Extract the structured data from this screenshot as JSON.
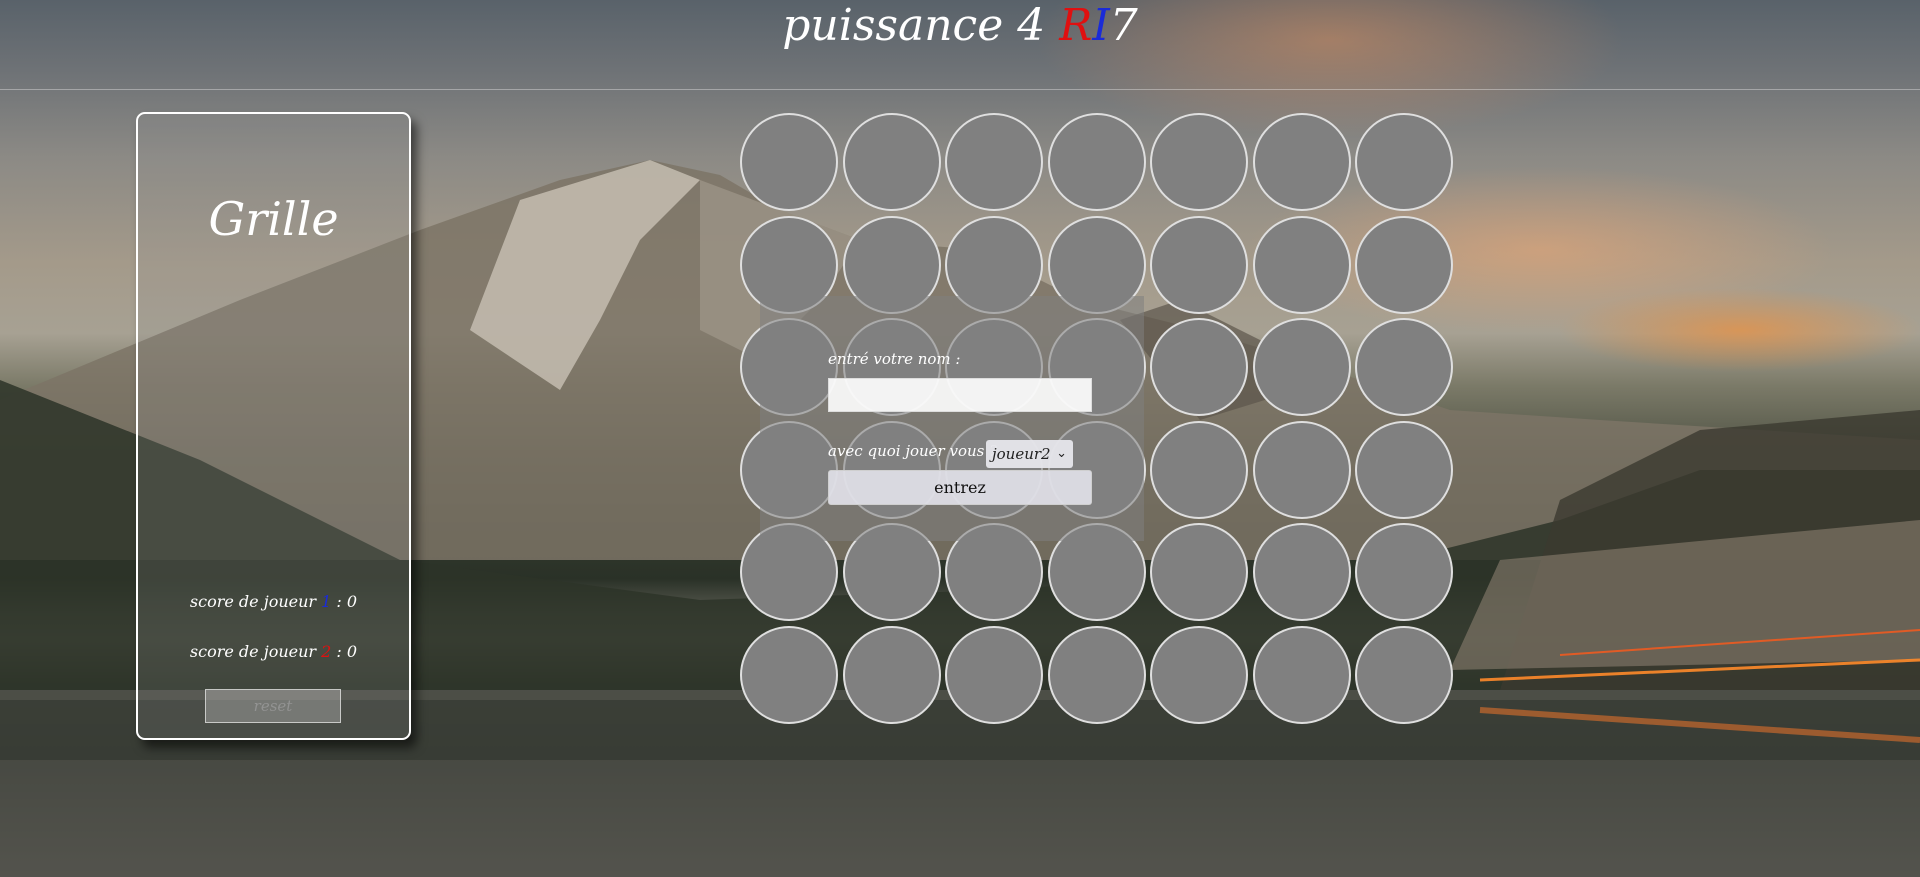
{
  "colors": {
    "accent_red": "#e01010",
    "accent_blue": "#1a2bd8",
    "cell_empty": "#808080"
  },
  "header": {
    "title_main": "puissance 4 ",
    "title_r": "R",
    "title_i": "I",
    "title_end": "7"
  },
  "sidebar": {
    "title": "Grille",
    "score_label": "score de joueur ",
    "score_sep": " : ",
    "player1_num": "1",
    "player1_score": "0",
    "player2_num": "2",
    "player2_score": "0",
    "reset_label": "reset"
  },
  "board": {
    "rows": 6,
    "cols": 7
  },
  "login": {
    "name_label": "entré votre nom :",
    "name_value": "",
    "opponent_label": "avec quoi jouer vous ?",
    "opponent_selected": "joueur2",
    "submit_label": "entrez"
  }
}
